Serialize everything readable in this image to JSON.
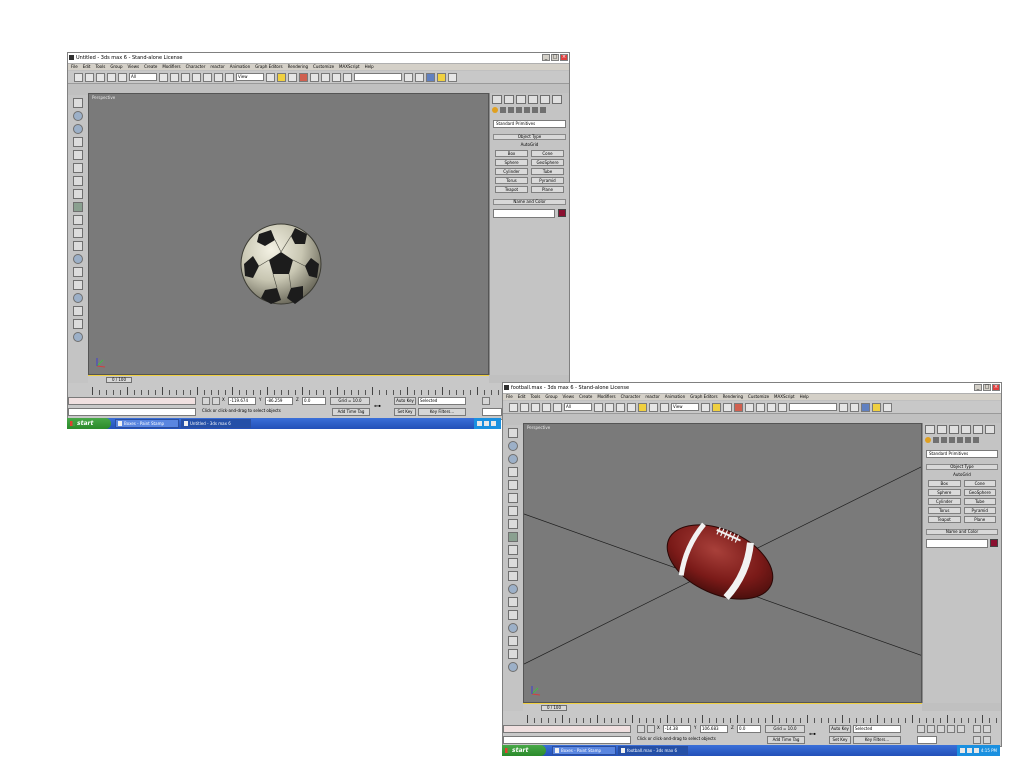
{
  "windows": [
    {
      "title": "Untitled - 3ds max 6 - Stand-alone License",
      "menu": [
        "File",
        "Edit",
        "Tools",
        "Group",
        "Views",
        "Create",
        "Modifiers",
        "Character",
        "reactor",
        "Animation",
        "Graph Editors",
        "Rendering",
        "Customize",
        "MAXScript",
        "Help"
      ],
      "toolbar_selects": [
        "All",
        "View"
      ],
      "viewport_label": "Perspective",
      "command_panel": {
        "dropdown": "Standard Primitives",
        "object_type_header": "Object Type",
        "autogrid": "AutoGrid",
        "buttons": [
          "Box",
          "Cone",
          "Sphere",
          "GeoSphere",
          "Cylinder",
          "Tube",
          "Torus",
          "Pyramid",
          "Teapot",
          "Plane"
        ],
        "name_color_header": "Name and Color"
      },
      "time_slider": "0 / 100",
      "status": {
        "selected": "",
        "prompt": "Click or click-and-drag to select objects",
        "add_time_tag": "Add Time Tag",
        "x": "-119.674",
        "y": "-86.259",
        "z": "0.0",
        "grid": "Grid = 10.0",
        "auto_key": "Auto Key",
        "set_key": "Set Key",
        "selected_filter": "Selected",
        "key_filters": "Key Filters..."
      }
    },
    {
      "title": "football.max - 3ds max 6 - Stand-alone License",
      "menu": [
        "File",
        "Edit",
        "Tools",
        "Group",
        "Views",
        "Create",
        "Modifiers",
        "Character",
        "reactor",
        "Animation",
        "Graph Editors",
        "Rendering",
        "Customize",
        "MAXScript",
        "Help"
      ],
      "toolbar_selects": [
        "All",
        "View"
      ],
      "viewport_label": "Perspective",
      "command_panel": {
        "dropdown": "Standard Primitives",
        "object_type_header": "Object Type",
        "autogrid": "AutoGrid",
        "buttons": [
          "Box",
          "Cone",
          "Sphere",
          "GeoSphere",
          "Cylinder",
          "Tube",
          "Torus",
          "Pyramid",
          "Teapot",
          "Plane"
        ],
        "name_color_header": "Name and Color"
      },
      "time_slider": "0 / 100",
      "status": {
        "selected": "",
        "prompt": "Click or click-and-drag to select objects",
        "add_time_tag": "Add Time Tag",
        "x": "-14.38",
        "y": "106.683",
        "z": "0.0",
        "grid": "Grid = 10.0",
        "auto_key": "Auto Key",
        "set_key": "Set Key",
        "selected_filter": "Selected",
        "key_filters": "Key Filters..."
      }
    }
  ],
  "taskbars": [
    {
      "start": "start",
      "items": [
        "Boxes - Paint Stamp",
        "Untitled - 3ds max 6"
      ],
      "time": ""
    },
    {
      "start": "start",
      "items": [
        "Boxes - Paint Stamp",
        "football.max - 3ds max 6"
      ],
      "time": "4:15 PM"
    }
  ],
  "colors": {
    "viewport": "#7a7a7a",
    "panel": "#c4c4c4",
    "football": "#7a1a18",
    "object_color": "#8a1030",
    "taskbar": "#2a5fcc",
    "start": "#3a9a3a"
  }
}
